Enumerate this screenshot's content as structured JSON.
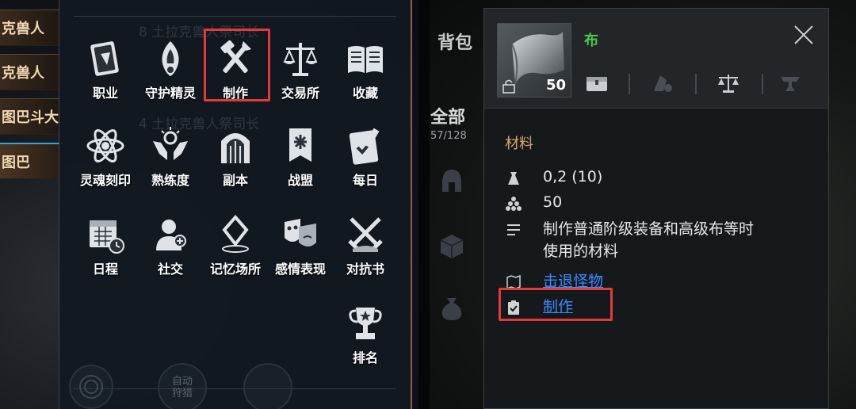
{
  "quest_list": [
    {
      "label": "克兽人",
      "active": false
    },
    {
      "label": "克兽人",
      "active": false
    },
    {
      "label": "图巴斗大",
      "active": false
    },
    {
      "label": "图巴",
      "active": true
    }
  ],
  "menu": {
    "background_text": [
      {
        "text": "8  土拉克兽人祭司长"
      },
      {
        "text": "4  土拉克兽人祭司长"
      }
    ],
    "rows": [
      [
        {
          "label": "职业",
          "icon": "class-card-icon"
        },
        {
          "label": "守护精灵",
          "icon": "guardian-spirit-icon"
        },
        {
          "label": "制作",
          "icon": "crafting-tools-icon",
          "highlighted": true
        },
        {
          "label": "交易所",
          "icon": "scales-icon"
        },
        {
          "label": "收藏",
          "icon": "book-icon"
        }
      ],
      [
        {
          "label": "灵魂刻印",
          "icon": "atom-icon"
        },
        {
          "label": "熟练度",
          "icon": "hands-icon"
        },
        {
          "label": "副本",
          "icon": "dungeon-gate-icon"
        },
        {
          "label": "战盟",
          "icon": "guild-banner-icon"
        },
        {
          "label": "每日",
          "icon": "daily-checklist-icon"
        }
      ],
      [
        {
          "label": "日程",
          "icon": "calendar-icon"
        },
        {
          "label": "社交",
          "icon": "social-person-icon"
        },
        {
          "label": "记忆场所",
          "icon": "location-pin-icon"
        },
        {
          "label": "感情表现",
          "icon": "masks-icon"
        },
        {
          "label": "对抗书",
          "icon": "crossed-swords-icon"
        }
      ],
      [
        {
          "label": "排名",
          "icon": "trophy-icon"
        }
      ]
    ],
    "auto_hunt_label": "自动狩猎"
  },
  "inventory": {
    "title": "背包",
    "filter_all": "全部",
    "count": "57/128"
  },
  "tooltip": {
    "item_name": "布",
    "item_name_color": "#48c94a",
    "quantity": "50",
    "section_title": "材料",
    "weight": "0,2 (10)",
    "stack": "50",
    "description_line1": "制作普通阶级装备和高级布等时",
    "description_line2": "使用的材料",
    "source_link": "击退怪物",
    "craft_link": "制作"
  },
  "colors": {
    "highlight": "#e23a3a",
    "link": "#3a8cff",
    "section_title": "#d9a86a"
  }
}
